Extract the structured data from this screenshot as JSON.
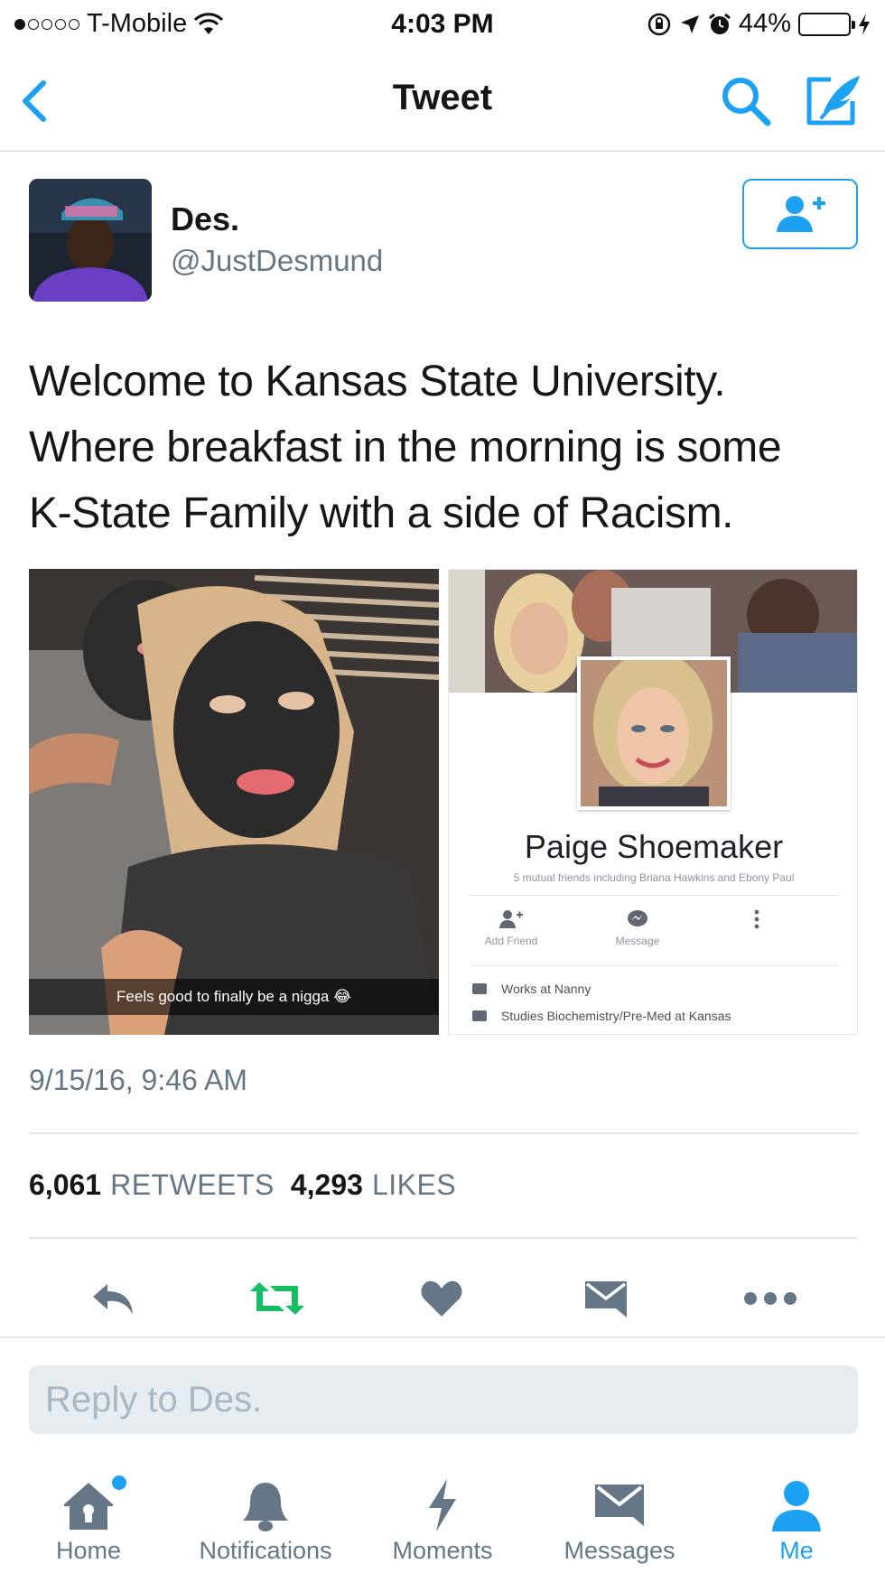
{
  "status_bar": {
    "carrier": "T-Mobile",
    "time": "4:03 PM",
    "battery": "44%",
    "battery_level": 0.44,
    "signal_bars": 1,
    "icons": [
      "wifi-icon",
      "orientation-lock-icon",
      "location-icon",
      "alarm-icon",
      "battery-icon",
      "charging-icon"
    ]
  },
  "nav": {
    "title": "Tweet",
    "icons": [
      "back-chevron-icon",
      "search-icon",
      "compose-icon"
    ]
  },
  "tweet": {
    "author_name": "Des.",
    "author_handle": "@JustDesmund",
    "text": "Welcome to Kansas State University.\nWhere breakfast in the morning is some\nK-State Family with a side of Racism.",
    "timestamp": "9/15/16, 9:46 AM",
    "retweets_count": "6,061",
    "retweets_label": "RETWEETS",
    "likes_count": "4,293",
    "likes_label": "LIKES"
  },
  "media": {
    "left_caption": "Feels good to finally be a nigga 😂",
    "fb_card": {
      "name": "Paige Shoemaker",
      "mutual": "5 mutual friends including Briana Hawkins and Ebony Paul",
      "add_friend": "Add Friend",
      "message": "Message",
      "work": "Works at Nanny",
      "studies": "Studies Biochemistry/Pre-Med at Kansas"
    }
  },
  "actions": [
    "reply-icon",
    "retweet-icon",
    "like-icon",
    "direct-message-icon",
    "more-icon"
  ],
  "colors": {
    "accent": "#1da1f2",
    "retweet": "#17bf63",
    "icon_gray": "#657786"
  },
  "reply": {
    "placeholder": "Reply to Des."
  },
  "tabs": [
    {
      "label": "Home",
      "icon": "home-icon"
    },
    {
      "label": "Notifications",
      "icon": "bell-icon"
    },
    {
      "label": "Moments",
      "icon": "lightning-icon"
    },
    {
      "label": "Messages",
      "icon": "envelope-icon"
    },
    {
      "label": "Me",
      "icon": "person-icon",
      "active": true
    }
  ]
}
